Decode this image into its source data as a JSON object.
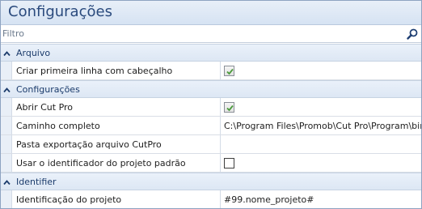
{
  "panel": {
    "title": "Configurações"
  },
  "filter": {
    "placeholder": "Filtro",
    "value": ""
  },
  "categories": [
    {
      "label": "Arquivo",
      "rows": [
        {
          "name": "Criar primeira linha com cabeçalho",
          "type": "checkbox",
          "checked": true
        }
      ]
    },
    {
      "label": "Configurações",
      "rows": [
        {
          "name": "Abrir Cut Pro",
          "type": "checkbox",
          "checked": true
        },
        {
          "name": "Caminho completo",
          "type": "text",
          "value": "C:\\Program Files\\Promob\\Cut Pro\\Program\\bin"
        },
        {
          "name": "Pasta exportação arquivo CutPro",
          "type": "text",
          "value": ""
        },
        {
          "name": "Usar o identificador do projeto padrão",
          "type": "checkbox",
          "checked": false
        }
      ]
    },
    {
      "label": "Identifier",
      "rows": [
        {
          "name": "Identificação do projeto",
          "type": "text",
          "value": "#99.nome_projeto#"
        }
      ]
    }
  ],
  "colors": {
    "accent": "#2a4a7d",
    "category_bg": "#dde7f4",
    "check": "#4b9a3c"
  },
  "icons": {
    "search": "magnifier-icon",
    "collapse": "chevron-up-icon",
    "check": "checkmark-icon"
  }
}
